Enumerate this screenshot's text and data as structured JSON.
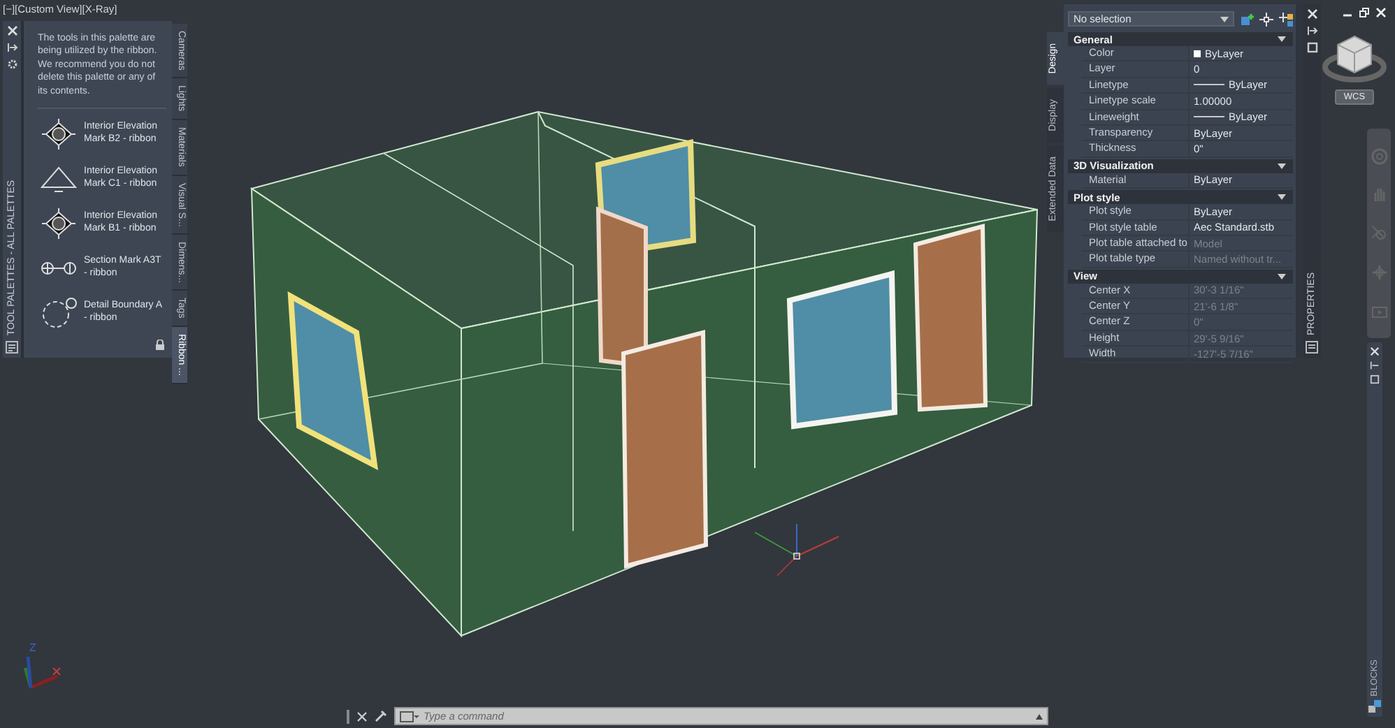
{
  "viewport": {
    "label": "[−][Custom View][X-Ray]"
  },
  "tool_palette": {
    "title": "TOOL PALETTES - ALL PALETTES",
    "message": "The tools in this palette are being utilized by the ribbon. We recommend you do not delete this palette or any of its contents.",
    "items": [
      {
        "label": "Interior Elevation Mark B2 - ribbon",
        "kind": "elevation_four"
      },
      {
        "label": "Interior Elevation Mark C1 - ribbon",
        "kind": "elevation_triangle"
      },
      {
        "label": "Interior Elevation Mark B1 - ribbon",
        "kind": "elevation_four"
      },
      {
        "label": "Section Mark A3T - ribbon",
        "kind": "section"
      },
      {
        "label": "Detail Boundary A - ribbon",
        "kind": "detail"
      }
    ],
    "tabs": [
      {
        "label": "Cameras",
        "selected": false
      },
      {
        "label": "Lights",
        "selected": false
      },
      {
        "label": "Materials",
        "selected": false
      },
      {
        "label": "Visual S...",
        "selected": false
      },
      {
        "label": "Dimens...",
        "selected": false
      },
      {
        "label": "Tags",
        "selected": false
      },
      {
        "label": "Ribbon ...",
        "selected": true
      }
    ]
  },
  "properties": {
    "title": "PROPERTIES",
    "selection": "No selection",
    "tabs": [
      {
        "label": "Design",
        "selected": true
      },
      {
        "label": "Display",
        "selected": false
      },
      {
        "label": "Extended Data",
        "selected": false
      }
    ],
    "sections": [
      {
        "title": "General",
        "expanded": true,
        "rows": [
          {
            "label": "Color",
            "value": "ByLayer",
            "kind": "swatch",
            "disabled": false
          },
          {
            "label": "Layer",
            "value": "0",
            "kind": "text",
            "disabled": false
          },
          {
            "label": "Linetype",
            "value": "ByLayer",
            "kind": "line",
            "disabled": false
          },
          {
            "label": "Linetype scale",
            "value": "1.00000",
            "kind": "text",
            "disabled": false
          },
          {
            "label": "Lineweight",
            "value": "ByLayer",
            "kind": "line",
            "disabled": false
          },
          {
            "label": "Transparency",
            "value": "ByLayer",
            "kind": "text",
            "disabled": false
          },
          {
            "label": "Thickness",
            "value": "0\"",
            "kind": "text",
            "disabled": false
          }
        ]
      },
      {
        "title": "3D Visualization",
        "expanded": true,
        "rows": [
          {
            "label": "Material",
            "value": "ByLayer",
            "kind": "text",
            "disabled": false
          }
        ]
      },
      {
        "title": "Plot style",
        "expanded": true,
        "rows": [
          {
            "label": "Plot style",
            "value": "ByLayer",
            "kind": "text",
            "disabled": false
          },
          {
            "label": "Plot style table",
            "value": "Aec Standard.stb",
            "kind": "text",
            "disabled": false
          },
          {
            "label": "Plot table attached to",
            "value": "Model",
            "kind": "text",
            "disabled": true
          },
          {
            "label": "Plot table type",
            "value": "Named without tr...",
            "kind": "text",
            "disabled": true
          }
        ]
      },
      {
        "title": "View",
        "expanded": true,
        "rows": [
          {
            "label": "Center X",
            "value": "30'-3 1/16\"",
            "kind": "text",
            "disabled": true
          },
          {
            "label": "Center Y",
            "value": "21'-6 1/8\"",
            "kind": "text",
            "disabled": true
          },
          {
            "label": "Center Z",
            "value": "0\"",
            "kind": "text",
            "disabled": true
          },
          {
            "label": "Height",
            "value": "29'-5 9/16\"",
            "kind": "text",
            "disabled": true
          },
          {
            "label": "Width",
            "value": "-127'-5 7/16\"",
            "kind": "text",
            "disabled": true
          }
        ]
      }
    ]
  },
  "view_cube": {
    "label": "WCS"
  },
  "ucs_icon": {
    "axis_label": "Z"
  },
  "blocks_palette": {
    "title": "BLOCKS"
  },
  "command_line": {
    "placeholder": "Type a command"
  }
}
